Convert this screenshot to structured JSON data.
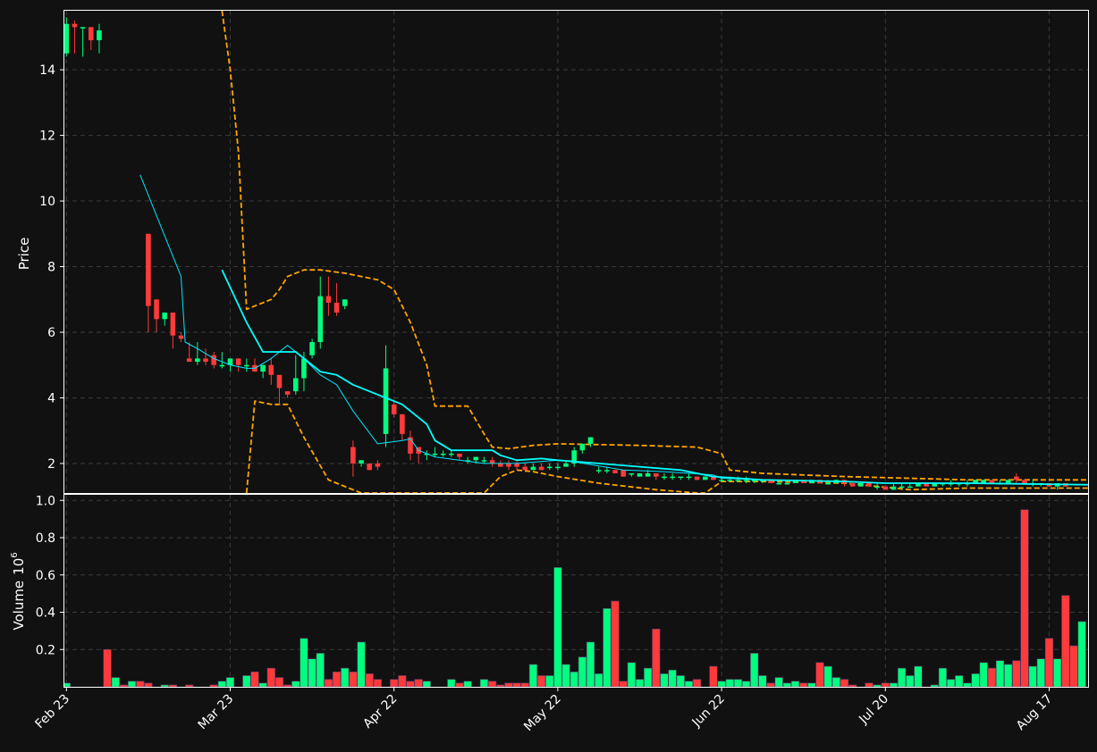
{
  "colors": {
    "background": "#111111",
    "up": "#00ff7f",
    "down": "#ff3a3a",
    "grid": "#3a3a3a",
    "ma_fast": "#00e5ff",
    "ma_slow": "#00ffff",
    "bands": "#ffa500",
    "frame": "#ffffff"
  },
  "chart_data": [
    {
      "type": "candlestick",
      "ylabel": "Price",
      "ylim": [
        1.1,
        15.8
      ],
      "yticks": [
        2,
        4,
        6,
        8,
        10,
        12,
        14
      ],
      "grid": true,
      "x_labels": [
        "Feb 23",
        "Mar 23",
        "Apr 22",
        "May 22",
        "Jun 22",
        "Jul 20",
        "Aug 17"
      ],
      "x_label_index": [
        0,
        20,
        40,
        60,
        80,
        100,
        120
      ],
      "ohlc": [
        [
          14.5,
          15.6,
          14.4,
          15.4
        ],
        [
          15.4,
          15.5,
          14.5,
          15.3
        ],
        [
          15.3,
          15.3,
          14.4,
          15.3
        ],
        [
          15.3,
          15.3,
          14.6,
          14.9
        ],
        [
          14.9,
          15.4,
          14.5,
          15.2
        ],
        null,
        null,
        null,
        null,
        null,
        [
          9.0,
          9.0,
          6.0,
          6.8
        ],
        [
          7.0,
          7.0,
          6.0,
          6.4
        ],
        [
          6.4,
          6.6,
          6.2,
          6.6
        ],
        [
          6.6,
          6.6,
          5.5,
          5.9
        ],
        [
          5.9,
          6.0,
          5.7,
          5.8
        ],
        [
          5.2,
          5.7,
          5.1,
          5.1
        ],
        [
          5.1,
          5.7,
          5.0,
          5.2
        ],
        [
          5.2,
          5.5,
          5.0,
          5.1
        ],
        [
          5.3,
          5.4,
          4.9,
          5.0
        ],
        [
          5.0,
          5.4,
          4.9,
          5.0
        ],
        [
          5.0,
          5.2,
          4.8,
          5.2
        ],
        [
          5.2,
          5.2,
          4.8,
          5.0
        ],
        [
          5.0,
          5.2,
          4.8,
          5.0
        ],
        [
          5.0,
          5.2,
          4.8,
          4.8
        ],
        [
          4.8,
          5.0,
          4.6,
          5.0
        ],
        [
          5.0,
          5.2,
          4.4,
          4.7
        ],
        [
          4.7,
          4.7,
          3.8,
          4.3
        ],
        [
          4.2,
          4.2,
          4.0,
          4.1
        ],
        [
          4.2,
          5.3,
          4.1,
          4.6
        ],
        [
          4.6,
          5.4,
          4.2,
          5.2
        ],
        [
          5.3,
          5.8,
          5.2,
          5.7
        ],
        [
          5.7,
          7.7,
          5.5,
          7.1
        ],
        [
          7.1,
          7.7,
          6.5,
          6.9
        ],
        [
          6.9,
          7.5,
          6.5,
          6.6
        ],
        [
          6.8,
          7.0,
          6.7,
          7.0
        ],
        [
          2.5,
          2.7,
          1.6,
          2.0
        ],
        [
          2.0,
          2.1,
          1.9,
          2.1
        ],
        [
          2.0,
          2.0,
          1.8,
          1.8
        ],
        [
          2.0,
          2.1,
          1.8,
          1.9
        ],
        [
          2.9,
          5.6,
          2.5,
          4.9
        ],
        [
          3.8,
          3.9,
          3.4,
          3.5
        ],
        [
          3.5,
          3.5,
          2.7,
          2.9
        ],
        [
          2.8,
          3.0,
          2.1,
          2.3
        ],
        [
          2.5,
          2.5,
          2.0,
          2.3
        ],
        [
          2.3,
          2.4,
          2.1,
          2.3
        ],
        [
          2.3,
          2.5,
          2.2,
          2.3
        ],
        [
          2.3,
          2.4,
          2.2,
          2.3
        ],
        [
          2.3,
          2.4,
          2.2,
          2.3
        ],
        [
          2.3,
          2.3,
          2.1,
          2.2
        ],
        [
          2.1,
          2.2,
          2.0,
          2.1
        ],
        [
          2.1,
          2.2,
          2.0,
          2.2
        ],
        [
          2.1,
          2.2,
          2.0,
          2.1
        ],
        [
          2.1,
          2.2,
          1.9,
          2.0
        ],
        [
          2.0,
          2.1,
          1.9,
          1.9
        ],
        [
          2.0,
          2.1,
          1.8,
          1.9
        ],
        [
          2.0,
          2.1,
          1.8,
          1.9
        ],
        [
          1.9,
          2.0,
          1.8,
          1.8
        ],
        [
          1.8,
          2.0,
          1.8,
          1.9
        ],
        [
          1.9,
          2.0,
          1.8,
          1.8
        ],
        [
          1.9,
          2.0,
          1.8,
          1.9
        ],
        [
          1.9,
          2.0,
          1.8,
          1.9
        ],
        [
          1.9,
          2.1,
          1.9,
          2.0
        ],
        [
          2.0,
          2.5,
          1.9,
          2.4
        ],
        [
          2.4,
          2.6,
          2.3,
          2.6
        ],
        [
          2.6,
          2.8,
          2.5,
          2.8
        ],
        [
          1.8,
          1.9,
          1.7,
          1.8
        ],
        [
          1.8,
          1.9,
          1.7,
          1.8
        ],
        [
          1.8,
          1.8,
          1.7,
          1.7
        ],
        [
          1.8,
          1.8,
          1.6,
          1.6
        ],
        [
          1.7,
          1.7,
          1.6,
          1.7
        ],
        [
          1.6,
          1.7,
          1.6,
          1.7
        ],
        [
          1.6,
          1.8,
          1.6,
          1.7
        ],
        [
          1.7,
          1.7,
          1.5,
          1.6
        ],
        [
          1.6,
          1.7,
          1.5,
          1.6
        ],
        [
          1.6,
          1.7,
          1.5,
          1.6
        ],
        [
          1.6,
          1.6,
          1.5,
          1.6
        ],
        [
          1.6,
          1.7,
          1.5,
          1.6
        ],
        [
          1.6,
          1.6,
          1.5,
          1.5
        ],
        [
          1.5,
          1.6,
          1.5,
          1.6
        ],
        [
          1.6,
          1.6,
          1.5,
          1.5
        ],
        [
          1.5,
          1.6,
          1.5,
          1.5
        ],
        [
          1.5,
          1.6,
          1.5,
          1.5
        ],
        [
          1.5,
          1.6,
          1.5,
          1.5
        ],
        [
          1.5,
          1.6,
          1.4,
          1.5
        ],
        [
          1.5,
          1.5,
          1.4,
          1.5
        ],
        [
          1.5,
          1.5,
          1.4,
          1.5
        ],
        [
          1.5,
          1.5,
          1.4,
          1.4
        ],
        [
          1.4,
          1.5,
          1.4,
          1.4
        ],
        [
          1.4,
          1.5,
          1.4,
          1.4
        ],
        [
          1.4,
          1.5,
          1.4,
          1.5
        ],
        [
          1.5,
          1.5,
          1.4,
          1.4
        ],
        [
          1.4,
          1.5,
          1.4,
          1.5
        ],
        [
          1.5,
          1.5,
          1.4,
          1.4
        ],
        [
          1.4,
          1.5,
          1.4,
          1.4
        ],
        [
          1.4,
          1.5,
          1.4,
          1.5
        ],
        [
          1.5,
          1.5,
          1.3,
          1.4
        ],
        [
          1.4,
          1.4,
          1.3,
          1.3
        ],
        [
          1.3,
          1.4,
          1.3,
          1.4
        ],
        [
          1.4,
          1.4,
          1.3,
          1.3
        ],
        [
          1.3,
          1.4,
          1.2,
          1.3
        ],
        [
          1.3,
          1.3,
          1.2,
          1.2
        ],
        [
          1.2,
          1.4,
          1.2,
          1.3
        ],
        [
          1.3,
          1.4,
          1.2,
          1.3
        ],
        [
          1.3,
          1.4,
          1.3,
          1.3
        ],
        [
          1.3,
          1.4,
          1.3,
          1.4
        ],
        [
          1.4,
          1.4,
          1.3,
          1.3
        ],
        [
          1.3,
          1.4,
          1.3,
          1.4
        ],
        [
          1.4,
          1.4,
          1.3,
          1.4
        ],
        [
          1.4,
          1.5,
          1.3,
          1.4
        ],
        [
          1.4,
          1.4,
          1.3,
          1.4
        ],
        [
          1.4,
          1.5,
          1.3,
          1.4
        ],
        [
          1.4,
          1.5,
          1.4,
          1.5
        ],
        [
          1.4,
          1.5,
          1.4,
          1.5
        ],
        [
          1.5,
          1.5,
          1.4,
          1.4
        ],
        [
          1.4,
          1.5,
          1.4,
          1.4
        ],
        [
          1.4,
          1.5,
          1.4,
          1.5
        ],
        [
          1.6,
          1.7,
          1.4,
          1.5
        ],
        [
          1.5,
          1.5,
          1.4,
          1.4
        ],
        [
          1.4,
          1.5,
          1.3,
          1.4
        ],
        [
          1.4,
          1.4,
          1.3,
          1.4
        ],
        [
          1.4,
          1.4,
          1.3,
          1.3
        ],
        [
          1.3,
          1.4,
          1.2,
          1.4
        ],
        [
          1.4,
          1.4,
          1.3,
          1.3
        ]
      ],
      "ma_fast": [
        [
          9,
          10.8
        ],
        [
          14,
          7.7
        ],
        [
          14.5,
          5.7
        ],
        [
          16,
          5.5
        ],
        [
          18,
          5.2
        ],
        [
          20,
          5.0
        ],
        [
          22,
          4.9
        ],
        [
          23,
          4.9
        ],
        [
          25,
          5.2
        ],
        [
          27,
          5.6
        ],
        [
          29,
          5.2
        ],
        [
          31,
          4.7
        ],
        [
          33,
          4.4
        ],
        [
          35,
          3.6
        ],
        [
          38,
          2.6
        ],
        [
          41,
          2.7
        ],
        [
          42,
          2.75
        ],
        [
          43,
          2.4
        ],
        [
          45,
          2.2
        ],
        [
          48,
          2.1
        ],
        [
          51,
          2.0
        ],
        [
          55,
          2.0
        ],
        [
          60,
          2.1
        ],
        [
          62,
          2.05
        ],
        [
          68,
          1.8
        ],
        [
          73,
          1.75
        ],
        [
          79,
          1.65
        ],
        [
          80,
          1.55
        ],
        [
          85,
          1.5
        ],
        [
          95,
          1.45
        ],
        [
          100,
          1.4
        ],
        [
          110,
          1.4
        ],
        [
          125,
          1.35
        ]
      ],
      "ma_slow": [
        [
          19,
          7.9
        ],
        [
          22,
          6.3
        ],
        [
          24,
          5.4
        ],
        [
          28,
          5.4
        ],
        [
          31,
          4.8
        ],
        [
          33,
          4.7
        ],
        [
          35,
          4.4
        ],
        [
          38,
          4.1
        ],
        [
          41,
          3.8
        ],
        [
          44,
          3.2
        ],
        [
          45,
          2.7
        ],
        [
          47,
          2.4
        ],
        [
          52,
          2.4
        ],
        [
          53,
          2.25
        ],
        [
          55,
          2.1
        ],
        [
          58,
          2.15
        ],
        [
          60,
          2.1
        ],
        [
          65,
          2.0
        ],
        [
          70,
          1.9
        ],
        [
          75,
          1.8
        ],
        [
          79,
          1.6
        ],
        [
          85,
          1.5
        ],
        [
          95,
          1.45
        ],
        [
          100,
          1.4
        ],
        [
          110,
          1.4
        ],
        [
          125,
          1.35
        ]
      ],
      "band_upper": [
        [
          19,
          15.8
        ],
        [
          20,
          14.0
        ],
        [
          21,
          11.5
        ],
        [
          22,
          6.7
        ],
        [
          25,
          7.0
        ],
        [
          26,
          7.3
        ],
        [
          27,
          7.7
        ],
        [
          29,
          7.9
        ],
        [
          31,
          7.9
        ],
        [
          34,
          7.8
        ],
        [
          38,
          7.6
        ],
        [
          40,
          7.3
        ],
        [
          42,
          6.3
        ],
        [
          44,
          5.0
        ],
        [
          45,
          3.75
        ],
        [
          49,
          3.75
        ],
        [
          51,
          2.9
        ],
        [
          52,
          2.5
        ],
        [
          54,
          2.45
        ],
        [
          57,
          2.55
        ],
        [
          60,
          2.6
        ],
        [
          70,
          2.55
        ],
        [
          77,
          2.5
        ],
        [
          80,
          2.3
        ],
        [
          81,
          1.8
        ],
        [
          85,
          1.7
        ],
        [
          95,
          1.6
        ],
        [
          103,
          1.55
        ],
        [
          110,
          1.5
        ],
        [
          125,
          1.5
        ]
      ],
      "band_lower": [
        [
          22,
          1.1
        ],
        [
          23,
          3.9
        ],
        [
          25,
          3.8
        ],
        [
          27,
          3.8
        ],
        [
          29,
          2.8
        ],
        [
          32,
          1.5
        ],
        [
          34,
          1.3
        ],
        [
          36,
          1.1
        ],
        [
          51,
          1.1
        ],
        [
          53,
          1.6
        ],
        [
          55,
          1.8
        ],
        [
          57,
          1.75
        ],
        [
          60,
          1.6
        ],
        [
          65,
          1.4
        ],
        [
          72,
          1.2
        ],
        [
          77,
          1.1
        ],
        [
          78,
          1.1
        ],
        [
          80,
          1.45
        ],
        [
          85,
          1.45
        ],
        [
          95,
          1.4
        ],
        [
          103,
          1.2
        ],
        [
          110,
          1.25
        ],
        [
          125,
          1.25
        ]
      ]
    },
    {
      "type": "bar",
      "ylabel": "Volume",
      "ylabel_multiplier": "10",
      "ylabel_exponent": "6",
      "ylim": [
        0,
        1.03
      ],
      "yticks": [
        0.2,
        0.4,
        0.6,
        0.8,
        1.0
      ],
      "grid": true,
      "values": [
        0.02,
        0.0,
        0.0,
        0.0,
        0.0,
        0.2,
        0.05,
        0.01,
        0.03,
        0.03,
        0.02,
        0.0,
        0.01,
        0.01,
        0.0,
        0.01,
        0.0,
        0.0,
        0.01,
        0.03,
        0.05,
        0.0,
        0.06,
        0.08,
        0.02,
        0.1,
        0.05,
        0.01,
        0.03,
        0.26,
        0.15,
        0.18,
        0.04,
        0.08,
        0.1,
        0.08,
        0.24,
        0.07,
        0.04,
        0.0,
        0.04,
        0.06,
        0.03,
        0.04,
        0.03,
        0.0,
        0.0,
        0.04,
        0.02,
        0.03,
        0.0,
        0.04,
        0.03,
        0.01,
        0.02,
        0.02,
        0.02,
        0.12,
        0.06,
        0.06,
        0.64,
        0.12,
        0.08,
        0.16,
        0.24,
        0.07,
        0.42,
        0.46,
        0.03,
        0.13,
        0.04,
        0.1,
        0.31,
        0.07,
        0.09,
        0.06,
        0.03,
        0.04,
        0.0,
        0.11,
        0.03,
        0.04,
        0.04,
        0.03,
        0.18,
        0.06,
        0.02,
        0.05,
        0.02,
        0.03,
        0.02,
        0.02,
        0.13,
        0.11,
        0.05,
        0.04,
        0.01,
        0.0,
        0.02,
        0.01,
        0.02,
        0.02,
        0.1,
        0.06,
        0.11,
        0.0,
        0.01,
        0.1,
        0.04,
        0.06,
        0.02,
        0.07,
        0.13,
        0.1,
        0.14,
        0.12,
        0.14,
        0.95,
        0.11,
        0.15,
        0.26,
        0.15,
        0.49,
        0.22,
        0.35
      ]
    }
  ]
}
